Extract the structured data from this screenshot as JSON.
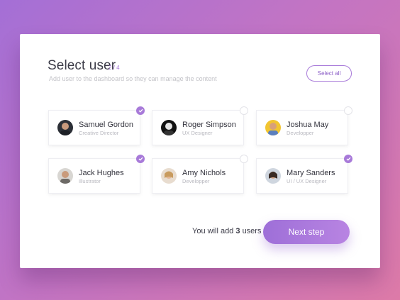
{
  "header": {
    "title": "Select user",
    "step": "2 / 4",
    "subtitle": "Add user to the dashboard so they can manage the content",
    "select_all_label": "Select all"
  },
  "users": [
    {
      "name": "Samuel Gordon",
      "role": "Creative Director",
      "selected": true
    },
    {
      "name": "Roger Simpson",
      "role": "UX Designer",
      "selected": false
    },
    {
      "name": "Joshua May",
      "role": "Developper",
      "selected": false
    },
    {
      "name": "Jack Hughes",
      "role": "Illustrator",
      "selected": true
    },
    {
      "name": "Amy Nichols",
      "role": "Developper",
      "selected": false
    },
    {
      "name": "Mary Sanders",
      "role": "UI / UX Designer",
      "selected": true
    }
  ],
  "footer": {
    "prefix": "You will add",
    "count": "3",
    "suffix": "users",
    "next_label": "Next step"
  },
  "colors": {
    "accent": "#a87ad9",
    "background_start": "#a46fd6",
    "background_end": "#dd7aa8"
  }
}
